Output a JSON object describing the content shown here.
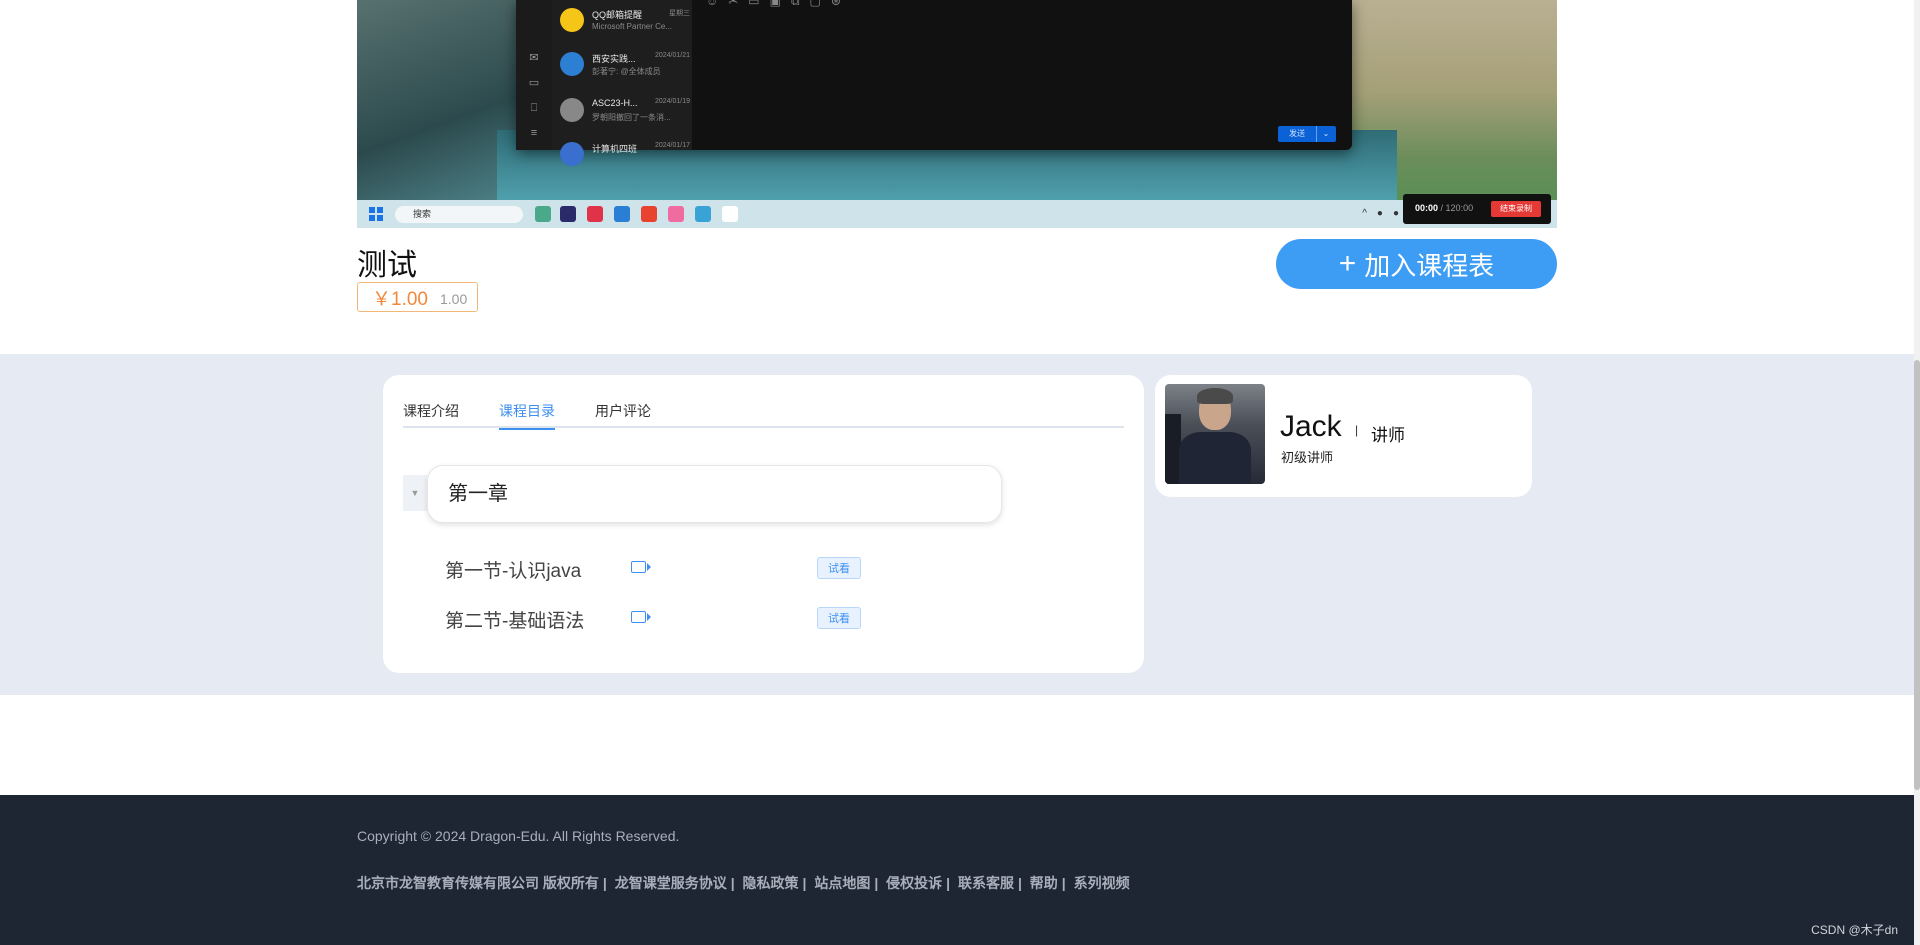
{
  "video": {
    "chat_items": [
      {
        "name": "QQ邮箱提醒",
        "sub": "Microsoft Partner Ce...",
        "date": "星期三"
      },
      {
        "name": "西安实践...",
        "sub": "彭著宁: @全体成员",
        "date": "2024/01/21"
      },
      {
        "name": "ASC23-H...",
        "sub": "罗朝阳撤回了一条消...",
        "date": "2024/01/19"
      },
      {
        "name": "计算机四班",
        "sub": "",
        "date": "2024/01/17"
      }
    ],
    "send_label": "发送",
    "search_label": "搜索",
    "rec_time_current": "00:00",
    "rec_time_sep": " / ",
    "rec_time_total": "120:00",
    "rec_stop_label": "结束录制"
  },
  "course": {
    "title": "测试",
    "price": "￥1.00",
    "original_price": "1.00",
    "add_button": "加入课程表",
    "add_icon": "+"
  },
  "tabs": [
    {
      "label": "课程介绍",
      "active": false
    },
    {
      "label": "课程目录",
      "active": true
    },
    {
      "label": "用户评论",
      "active": false
    }
  ],
  "catalog": {
    "chapter": "第一章",
    "sections": [
      {
        "name": "第一节-认识java",
        "trial": "试看"
      },
      {
        "name": "第二节-基础语法",
        "trial": "试看"
      }
    ]
  },
  "teacher": {
    "name": "Jack",
    "separator": "|",
    "role": "讲师",
    "level": "初级讲师"
  },
  "footer": {
    "copyright": "Copyright © 2024 Dragon-Edu. All Rights Reserved.",
    "links": [
      "北京市龙智教育传媒有限公司 版权所有",
      "|",
      "龙智课堂服务协议",
      "|",
      "隐私政策",
      "|",
      "站点地图",
      "|",
      "侵权投诉",
      "|",
      "联系客服",
      "|",
      "帮助",
      "|",
      "系列视频"
    ],
    "watermark": "CSDN @木子dn"
  },
  "colors": {
    "accent": "#3d9df5",
    "price": "#f0893b",
    "band": "#e6eaf3",
    "footer": "#1f2633"
  }
}
